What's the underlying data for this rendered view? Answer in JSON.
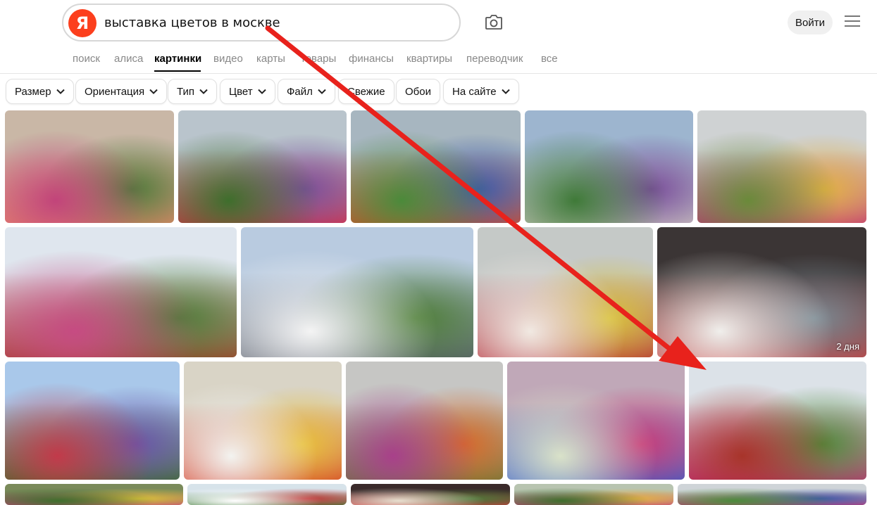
{
  "header": {
    "logo_letter": "Я",
    "query": "выставка цветов в москве",
    "login_label": "Войти"
  },
  "tabs": [
    {
      "label": "поиск",
      "active": false
    },
    {
      "label": "алиса",
      "active": false
    },
    {
      "label": "картинки",
      "active": true
    },
    {
      "label": "видео",
      "active": false
    },
    {
      "label": "карты",
      "active": false
    },
    {
      "label": "товары",
      "active": false
    },
    {
      "label": "финансы",
      "active": false
    },
    {
      "label": "квартиры",
      "active": false
    },
    {
      "label": "переводчик",
      "active": false
    },
    {
      "label": "все",
      "active": false
    }
  ],
  "filters": [
    {
      "label": "Размер",
      "dropdown": true
    },
    {
      "label": "Ориентация",
      "dropdown": true
    },
    {
      "label": "Тип",
      "dropdown": true
    },
    {
      "label": "Цвет",
      "dropdown": true
    },
    {
      "label": "Файл",
      "dropdown": true
    },
    {
      "label": "Свежие",
      "dropdown": false
    },
    {
      "label": "Обои",
      "dropdown": false
    },
    {
      "label": "На сайте",
      "dropdown": true
    }
  ],
  "results": [
    {
      "badge": "",
      "colors": [
        "#c9b7a6",
        "#e98a6b",
        "#c2447a",
        "#4f7a3a"
      ]
    },
    {
      "badge": "",
      "colors": [
        "#b9c4cc",
        "#d8344a",
        "#3e6e2c",
        "#7b4f9a"
      ]
    },
    {
      "badge": "",
      "colors": [
        "#a7b6c0",
        "#d94e2a",
        "#4b8a3a",
        "#3f5aa8"
      ]
    },
    {
      "badge": "",
      "colors": [
        "#9db5cf",
        "#cfcac2",
        "#3f7a38",
        "#7a4d9a"
      ]
    },
    {
      "badge": "",
      "colors": [
        "#cfd2d3",
        "#c0317a",
        "#6a8a3a",
        "#e3b144"
      ]
    },
    {
      "badge": "",
      "colors": [
        "#dfe6ee",
        "#a8442f",
        "#c64b82",
        "#4f7d39"
      ]
    },
    {
      "badge": "",
      "colors": [
        "#b9cbe0",
        "#5b6270",
        "#f4f4f4",
        "#4f7f38"
      ]
    },
    {
      "badge": "",
      "colors": [
        "#c5c9c7",
        "#b22a36",
        "#f1e9e2",
        "#d9c23a"
      ]
    },
    {
      "badge": "2 дня",
      "colors": [
        "#3b3535",
        "#c23a3a",
        "#f0efec",
        "#7b8a93"
      ]
    },
    {
      "badge": "",
      "colors": [
        "#a9c8ea",
        "#3e6e2a",
        "#c23a4a",
        "#6a55a8"
      ]
    },
    {
      "badge": "",
      "colors": [
        "#d9d4c6",
        "#d4402a",
        "#f3f3f0",
        "#e8c03a"
      ]
    },
    {
      "badge": "",
      "colors": [
        "#c6c6c4",
        "#6a7a3a",
        "#a8408a",
        "#d86a2a"
      ]
    },
    {
      "badge": "",
      "colors": [
        "#c0a8b8",
        "#3b5fc8",
        "#d9e2c9",
        "#c83a78"
      ]
    },
    {
      "badge": "",
      "colors": [
        "#dce2e8",
        "#c3337a",
        "#a8342a",
        "#4f8a3a"
      ]
    },
    {
      "badge": "",
      "colors": [
        "#7a8a5a",
        "#c2447a",
        "#3e6e2c",
        "#d9c23a"
      ]
    },
    {
      "badge": "",
      "colors": [
        "#d7e3ea",
        "#3f7a38",
        "#ffffff",
        "#c23a3a"
      ]
    },
    {
      "badge": "",
      "colors": [
        "#3a2a2a",
        "#c23a3a",
        "#e8e0d0",
        "#4f7a3a"
      ]
    },
    {
      "badge": "",
      "colors": [
        "#b8c4b0",
        "#c2447a",
        "#3e6e2c",
        "#e3b144"
      ]
    },
    {
      "badge": "",
      "colors": [
        "#cfd4d8",
        "#c23a7a",
        "#4b8a3a",
        "#3f5aa8"
      ]
    }
  ],
  "annotation": {
    "arrow_color": "#e8221c"
  }
}
